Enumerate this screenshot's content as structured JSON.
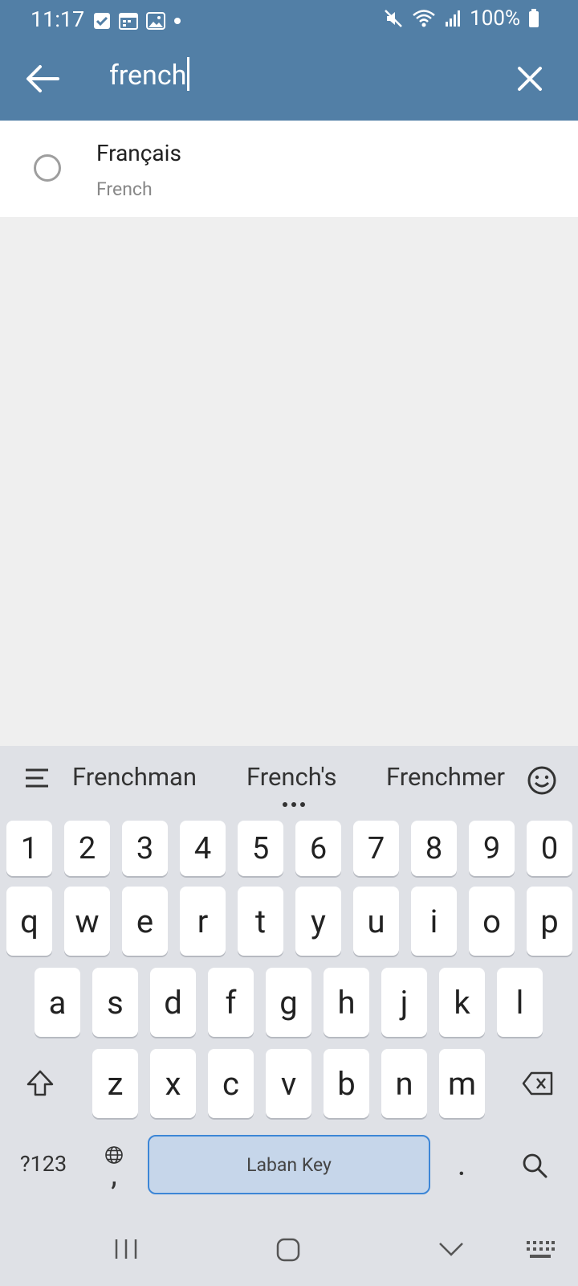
{
  "status": {
    "time": "11:17",
    "battery": "100%"
  },
  "search": {
    "query": "french"
  },
  "results": [
    {
      "name": "Français",
      "subtitle": "French"
    }
  ],
  "keyboard": {
    "suggestions": [
      "Frenchman",
      "French's",
      "Frenchmer"
    ],
    "row_numbers": [
      "1",
      "2",
      "3",
      "4",
      "5",
      "6",
      "7",
      "8",
      "9",
      "0"
    ],
    "row1": [
      "q",
      "w",
      "e",
      "r",
      "t",
      "y",
      "u",
      "i",
      "o",
      "p"
    ],
    "row2": [
      "a",
      "s",
      "d",
      "f",
      "g",
      "h",
      "j",
      "k",
      "l"
    ],
    "row3": [
      "z",
      "x",
      "c",
      "v",
      "b",
      "n",
      "m"
    ],
    "symbols_label": "?123",
    "comma": ",",
    "space_label": "Laban Key",
    "period": "."
  },
  "colors": {
    "app_bar": "#527fa6",
    "accent": "#3d86d6"
  }
}
